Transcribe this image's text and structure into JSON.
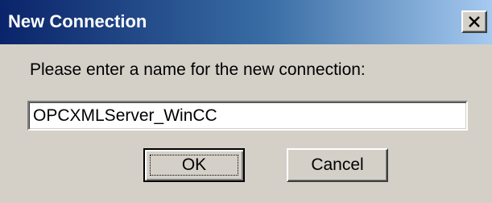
{
  "window": {
    "title": "New Connection",
    "close_icon": "close-icon"
  },
  "dialog": {
    "prompt": "Please enter a name for the new connection:",
    "name_value": "OPCXMLServer_WinCC",
    "ok_label": "OK",
    "cancel_label": "Cancel"
  },
  "colors": {
    "titlebar_start": "#0a246a",
    "titlebar_end": "#a6caf0",
    "face": "#d4d0c8"
  }
}
